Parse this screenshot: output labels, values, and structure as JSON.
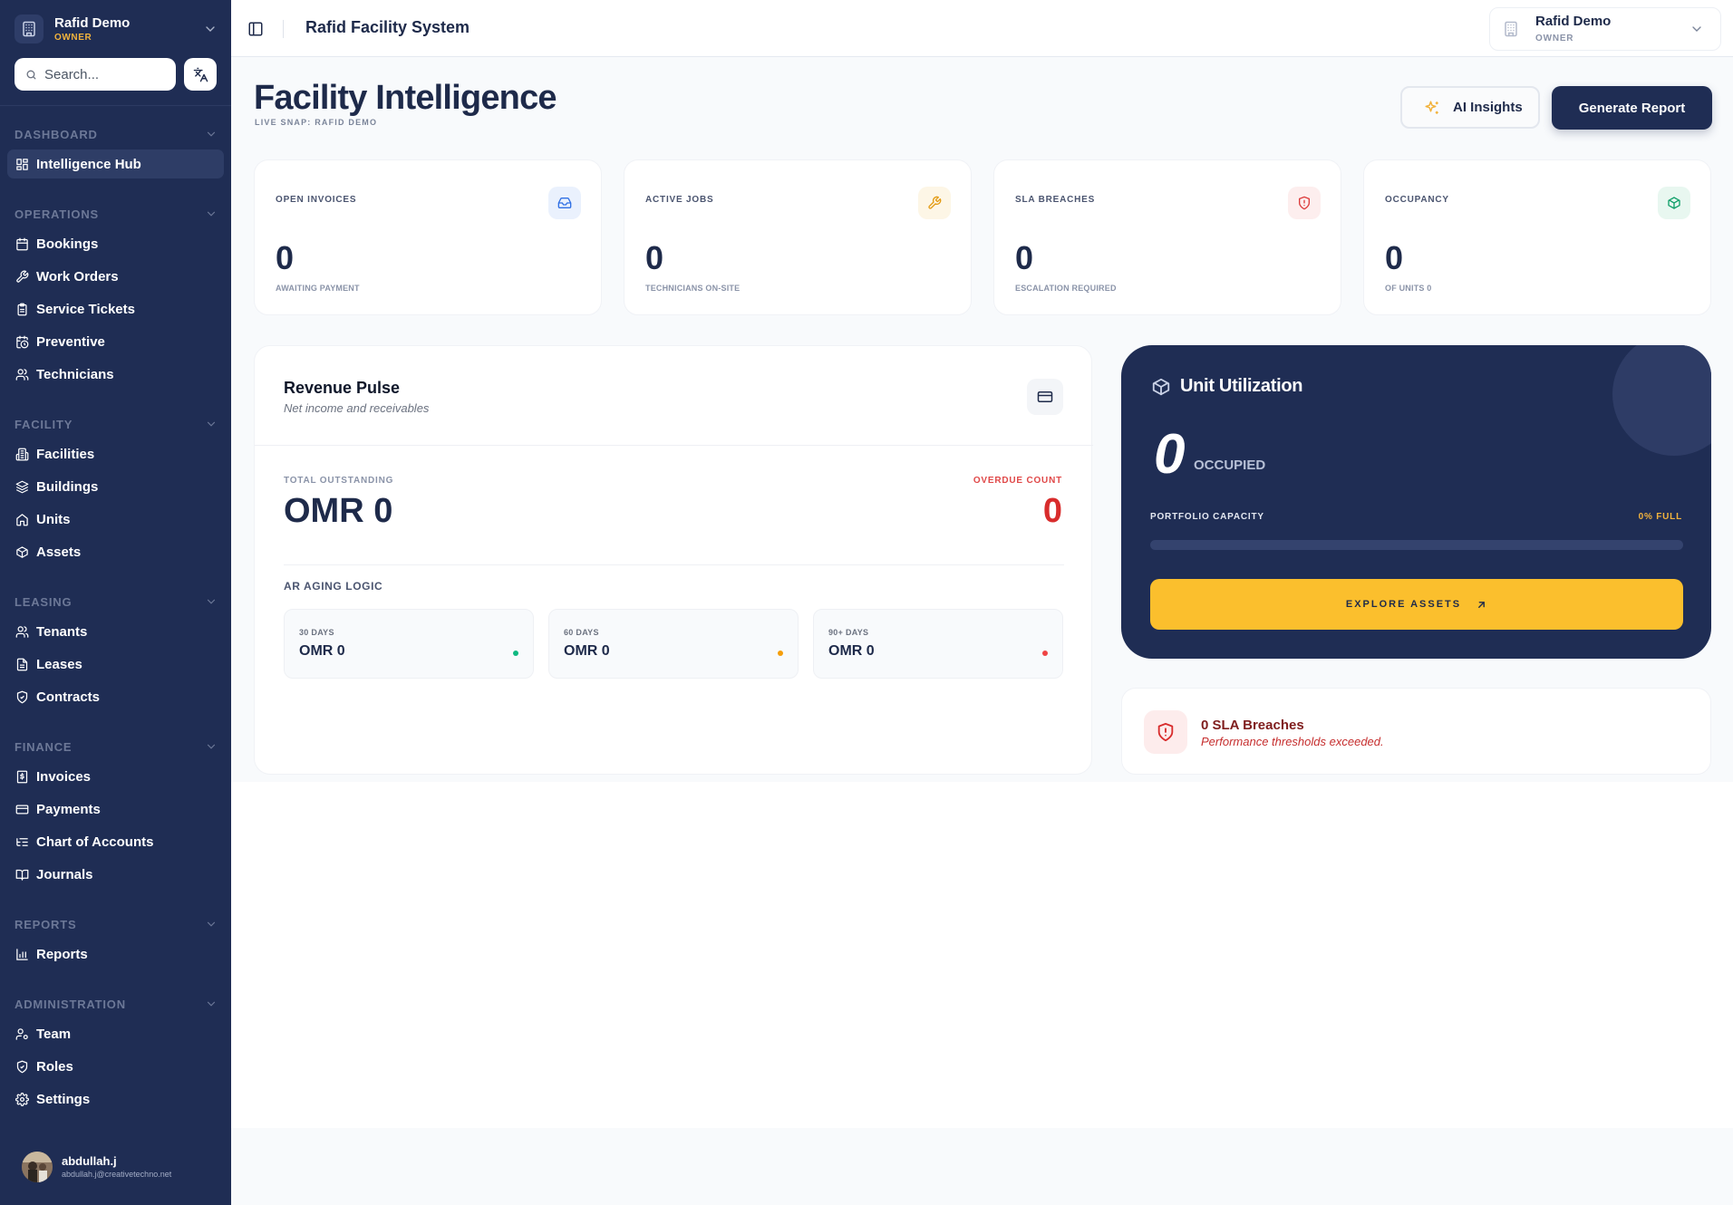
{
  "org": {
    "name": "Rafid Demo",
    "role": "OWNER"
  },
  "search": {
    "placeholder": "Search..."
  },
  "sidebar": {
    "sections": [
      {
        "label": "DASHBOARD",
        "items": [
          {
            "label": "Intelligence Hub",
            "icon": "grid-icon",
            "active": true
          }
        ]
      },
      {
        "label": "OPERATIONS",
        "items": [
          {
            "label": "Bookings",
            "icon": "calendar-icon"
          },
          {
            "label": "Work Orders",
            "icon": "wrench-icon"
          },
          {
            "label": "Service Tickets",
            "icon": "clipboard-icon"
          },
          {
            "label": "Preventive",
            "icon": "calendar-clock-icon"
          },
          {
            "label": "Technicians",
            "icon": "users-icon"
          }
        ]
      },
      {
        "label": "FACILITY",
        "items": [
          {
            "label": "Facilities",
            "icon": "building-icon"
          },
          {
            "label": "Buildings",
            "icon": "layers-icon"
          },
          {
            "label": "Units",
            "icon": "home-icon"
          },
          {
            "label": "Assets",
            "icon": "package-icon"
          }
        ]
      },
      {
        "label": "LEASING",
        "items": [
          {
            "label": "Tenants",
            "icon": "users-icon"
          },
          {
            "label": "Leases",
            "icon": "file-text-icon"
          },
          {
            "label": "Contracts",
            "icon": "shield-check-icon"
          }
        ]
      },
      {
        "label": "FINANCE",
        "items": [
          {
            "label": "Invoices",
            "icon": "receipt-icon"
          },
          {
            "label": "Payments",
            "icon": "credit-card-icon"
          },
          {
            "label": "Chart of Accounts",
            "icon": "list-tree-icon"
          },
          {
            "label": "Journals",
            "icon": "book-open-icon"
          }
        ]
      },
      {
        "label": "REPORTS",
        "items": [
          {
            "label": "Reports",
            "icon": "bar-chart-icon"
          }
        ]
      },
      {
        "label": "ADMINISTRATION",
        "items": [
          {
            "label": "Team",
            "icon": "user-cog-icon"
          },
          {
            "label": "Roles",
            "icon": "shield-check-icon"
          },
          {
            "label": "Settings",
            "icon": "gear-icon"
          }
        ]
      }
    ]
  },
  "user": {
    "name": "abdullah.j",
    "email": "abdullah.j@creativetechno.net"
  },
  "header": {
    "app_title": "Rafid Facility System"
  },
  "account": {
    "name": "Rafid Demo",
    "role": "OWNER"
  },
  "page": {
    "title": "Facility Intelligence",
    "subtitle": "LIVE SNAP: RAFID DEMO"
  },
  "actions": {
    "ai_insights": "AI Insights",
    "generate_report": "Generate Report"
  },
  "stats": [
    {
      "label": "OPEN INVOICES",
      "value": "0",
      "sub": "AWAITING PAYMENT",
      "icon": "inbox-icon",
      "accent": "#2f6fe4",
      "accent_bg": "#eaf1fd"
    },
    {
      "label": "ACTIVE JOBS",
      "value": "0",
      "sub": "TECHNICIANS ON-SITE",
      "icon": "wrench-icon",
      "accent": "#e39a10",
      "accent_bg": "#fdf6e6"
    },
    {
      "label": "SLA BREACHES",
      "value": "0",
      "sub": "ESCALATION REQUIRED",
      "icon": "shield-alert-icon",
      "accent": "#dc3b3b",
      "accent_bg": "#fdeeee"
    },
    {
      "label": "OCCUPANCY",
      "value": "0",
      "sub": "OF UNITS 0",
      "icon": "package-icon",
      "accent": "#12a06a",
      "accent_bg": "#e8f7f0"
    }
  ],
  "revenue": {
    "title": "Revenue Pulse",
    "subtitle": "Net income and receivables",
    "icon": "credit-card-icon",
    "total_label": "TOTAL OUTSTANDING",
    "total_value": "OMR 0",
    "overdue_label": "OVERDUE COUNT",
    "overdue_value": "0",
    "aging_title": "AR AGING LOGIC",
    "aging": [
      {
        "label": "30 DAYS",
        "value": "OMR 0",
        "color": "#10b981"
      },
      {
        "label": "60 DAYS",
        "value": "OMR 0",
        "color": "#f59e0b"
      },
      {
        "label": "90+ DAYS",
        "value": "OMR 0",
        "color": "#ef4444"
      }
    ]
  },
  "utilization": {
    "title": "Unit Utilization",
    "icon": "package-icon",
    "occupied_value": "0",
    "occupied_label": "OCCUPIED",
    "capacity_label": "PORTFOLIO CAPACITY",
    "capacity_value": "0% FULL",
    "capacity_fraction": 0,
    "explore_label": "EXPLORE ASSETS",
    "explore_icon": "arrow-up-right-icon"
  },
  "sla_alert": {
    "title": "0 SLA Breaches",
    "subtitle": "Performance thresholds exceeded.",
    "icon": "shield-alert-icon"
  },
  "colors": {
    "sidebar": "#1f2d54",
    "brand_navy": "#1f2d54",
    "accent_gold": "#fbbf2d",
    "danger": "#d82c2c"
  }
}
